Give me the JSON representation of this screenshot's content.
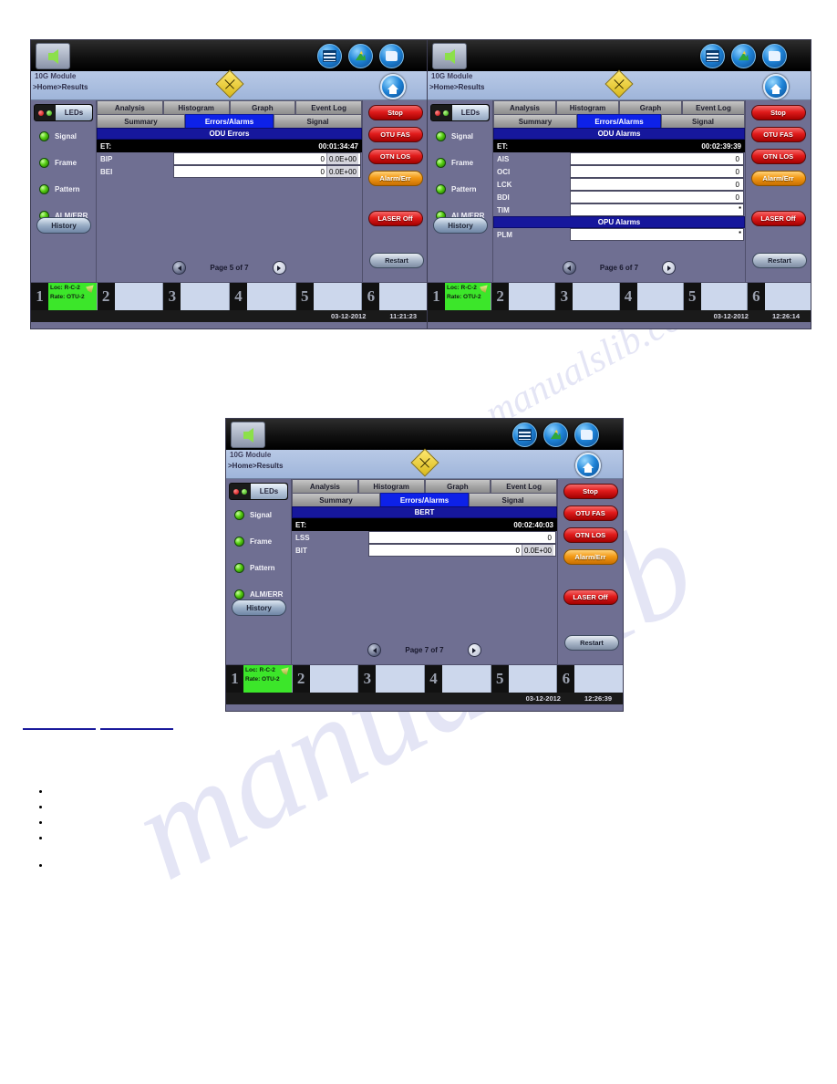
{
  "toolbar": {
    "back_label": "back-arrow",
    "icons": [
      {
        "name": "keypad-icon",
        "label": ""
      },
      {
        "name": "wizard-icon",
        "label": ""
      },
      {
        "name": "folder-icon",
        "label": ""
      }
    ]
  },
  "header": {
    "module": "10G Module",
    "breadcrumb": ">Home>Results",
    "home_label": "home"
  },
  "leds": {
    "header_label": "LEDs",
    "items": [
      "Signal",
      "Frame",
      "Pattern",
      "ALM/ERR"
    ],
    "history_label": "History"
  },
  "tabs_top": [
    "Analysis",
    "Histogram",
    "Graph",
    "Event Log"
  ],
  "tabs_bottom": [
    "Summary",
    "Errors/Alarms",
    "Signal"
  ],
  "rail": {
    "stop": "Stop",
    "otu_fas": "OTU FAS",
    "otn_los": "OTN LOS",
    "alarm_err": "Alarm/Err",
    "laser": "LASER Off",
    "restart": "Restart"
  },
  "ports": {
    "active_index": 1,
    "numbers": [
      "1",
      "2",
      "3",
      "4",
      "5",
      "6"
    ],
    "loc_label": "Loc: R-C-2",
    "rate_label": "Rate: OTU-2"
  },
  "screens": [
    {
      "id": "screen-odu-errors",
      "section_title": "ODU Errors",
      "et_label": "ET:",
      "et_value": "00:01:34:47",
      "rows": [
        {
          "label": "BIP",
          "count": "0",
          "sci": "0.0E+00"
        },
        {
          "label": "BEI",
          "count": "0",
          "sci": "0.0E+00"
        }
      ],
      "subsection": null,
      "sub_rows": [],
      "page_label": "Page 5 of 7",
      "date": "03-12-2012",
      "time": "11:21:23"
    },
    {
      "id": "screen-odu-alarms",
      "section_title": "ODU Alarms",
      "et_label": "ET:",
      "et_value": "00:02:39:39",
      "rows": [
        {
          "label": "AIS",
          "count": "0",
          "sci": null
        },
        {
          "label": "OCI",
          "count": "0",
          "sci": null
        },
        {
          "label": "LCK",
          "count": "0",
          "sci": null
        },
        {
          "label": "BDI",
          "count": "0",
          "sci": null
        },
        {
          "label": "TIM",
          "count": "",
          "sci": null,
          "mark": "▪"
        }
      ],
      "subsection": "OPU Alarms",
      "sub_rows": [
        {
          "label": "PLM",
          "count": "",
          "sci": null,
          "mark": "▪"
        }
      ],
      "page_label": "Page 6 of 7",
      "date": "03-12-2012",
      "time": "12:26:14"
    },
    {
      "id": "screen-bert",
      "section_title": "BERT",
      "et_label": "ET:",
      "et_value": "00:02:40:03",
      "rows": [
        {
          "label": "LSS",
          "count": "0",
          "sci": null
        },
        {
          "label": "BIT",
          "count": "0",
          "sci": "0.0E+00"
        }
      ],
      "subsection": null,
      "sub_rows": [],
      "page_label": "Page 7 of 7",
      "date": "03-12-2012",
      "time": "12:26:39"
    }
  ],
  "watermark": {
    "line1": "manualslib",
    "line2": "manualslib.com"
  },
  "colors": {
    "tab_active": "#0d21e8",
    "section_header": "#16179c",
    "panel_bg": "#6f6f92",
    "alarm_red": "#e01b1b",
    "alarm_orange": "#f39a16",
    "port_active": "#3ce62a"
  }
}
